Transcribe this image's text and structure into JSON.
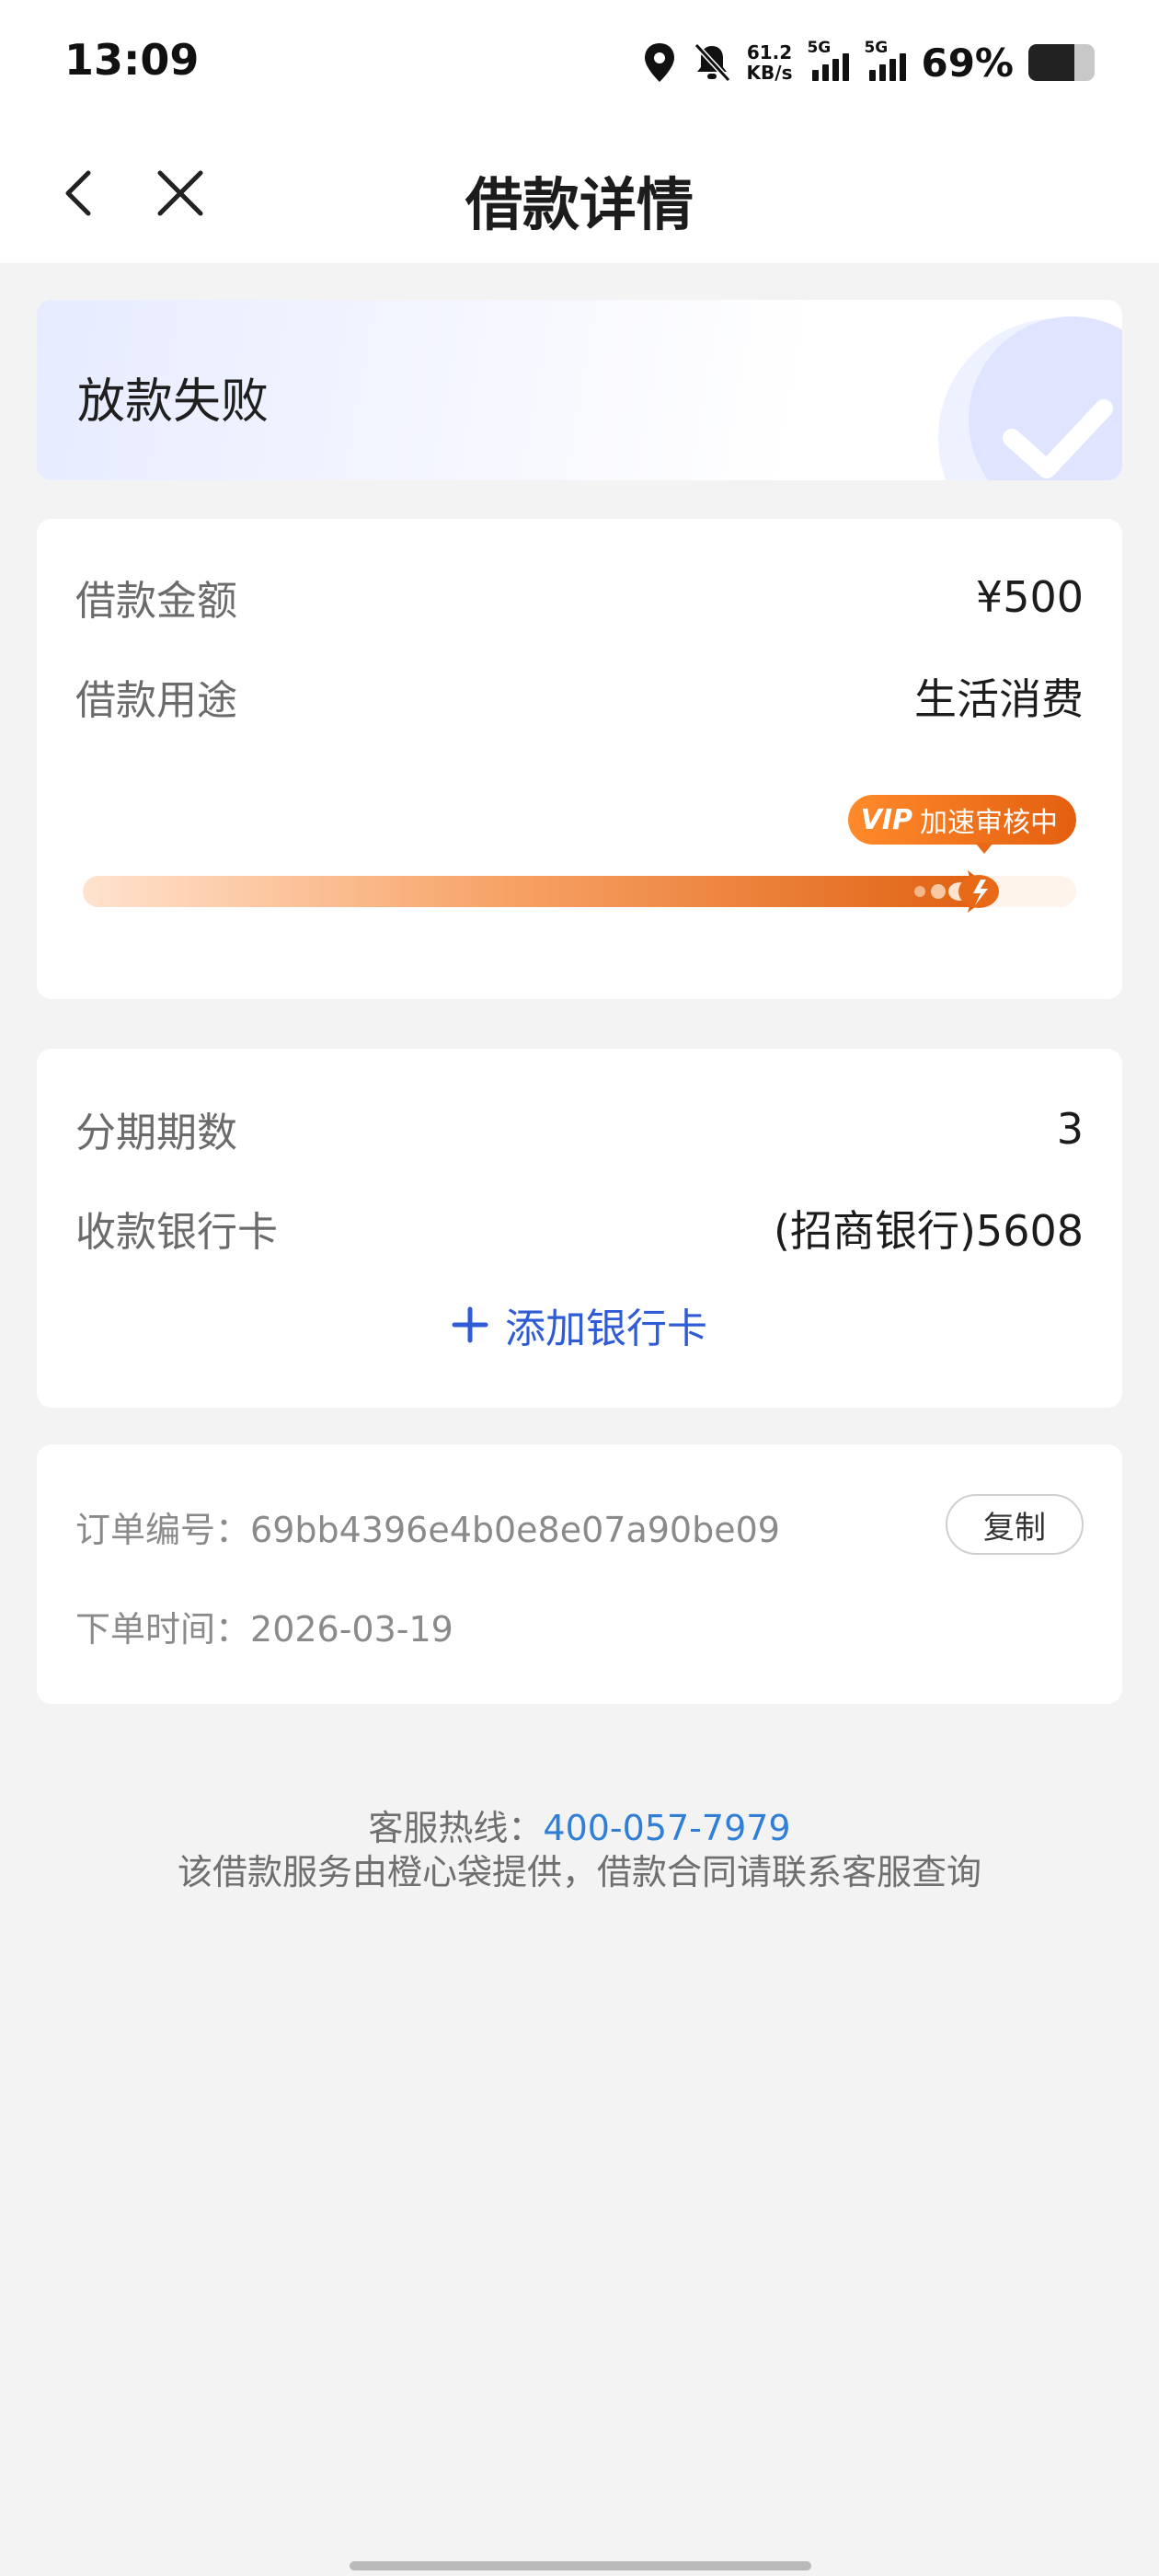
{
  "status_bar": {
    "time": "13:09",
    "speed_value": "61.2",
    "speed_unit": "KB/s",
    "net1": "5G",
    "net2": "5G",
    "battery": "69%",
    "icons": [
      "location-icon",
      "mute-bell-icon",
      "signal-icon",
      "battery-icon"
    ]
  },
  "nav": {
    "title": "借款详情",
    "icons": [
      "back-arrow-icon",
      "close-icon"
    ]
  },
  "loan_status": {
    "text": "放款失败"
  },
  "loan": {
    "amount_label": "借款金额",
    "amount_value": "¥500",
    "purpose_label": "借款用途",
    "purpose_value": "生活消费",
    "badge_vip": "VIP",
    "badge_text": "加速审核中",
    "progress": 0.92
  },
  "installment": {
    "periods_label": "分期期数",
    "periods_value": "3",
    "bank_label": "收款银行卡",
    "bank_value": "(招商银行)5608",
    "add_card_label": "添加银行卡"
  },
  "order": {
    "number_label": "订单编号：",
    "number_value": "69bb4396e4b0e8e07a90be09",
    "copy_label": "复制",
    "time_label": "下单时间：",
    "time_value": "2026-03-19"
  },
  "footer": {
    "hotline_label": "客服热线：",
    "hotline_value": "400-057-7979",
    "disclaimer": "该借款服务由橙心袋提供，借款合同请联系客服查询"
  },
  "colors": {
    "accent_blue": "#2f5bd6",
    "link_blue": "#2f7fd6",
    "progress_orange": "#e0600f"
  }
}
